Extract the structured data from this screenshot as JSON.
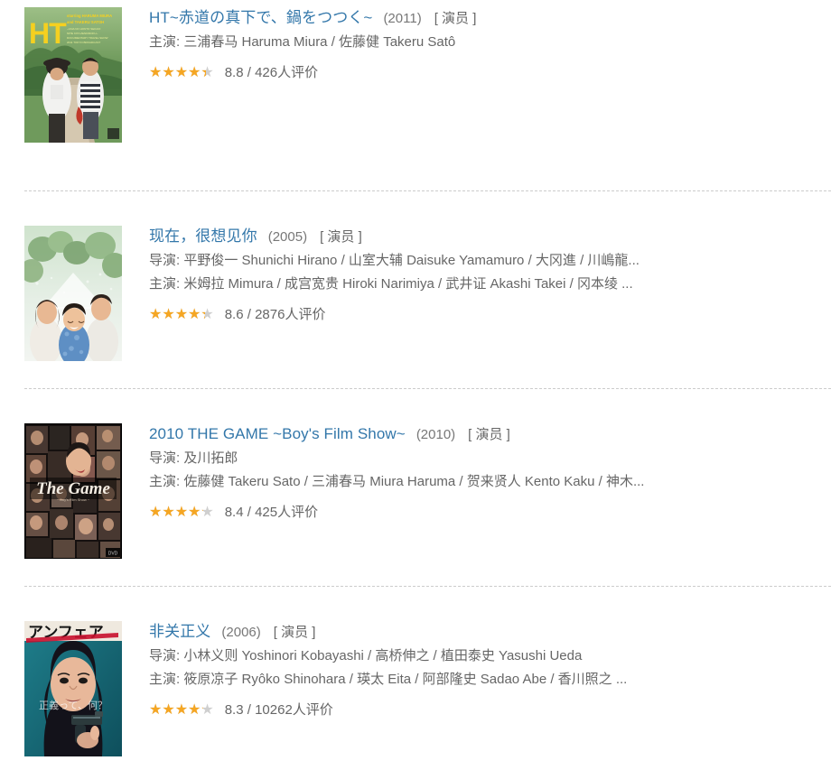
{
  "page": {
    "accent_link_color": "#3377aa",
    "star_color": "#f5a623",
    "star_empty_color": "#cfcfcf",
    "text_color": "#666666"
  },
  "rating_suffix": "人评价",
  "items": [
    {
      "title": "HT~赤道の真下で、鍋をつつく~",
      "year": "(2011)",
      "role": "[ 演员 ]",
      "credits": [
        "主演: 三浦春马 Haruma Miura / 佐藤健 Takeru Satô"
      ],
      "rating": "8.8",
      "votes": "426",
      "rating_text": "8.8 / 426人评价",
      "stars_percent": 88,
      "poster_alt": "HT~赤道の真下で、鍋をつつく~ 海报"
    },
    {
      "title": "现在，很想见你",
      "year": "(2005)",
      "role": "[ 演员 ]",
      "credits": [
        "导演: 平野俊一 Shunichi Hirano / 山室大辅 Daisuke Yamamuro / 大冈進 / 川嶋龍...",
        "主演: 米姆拉 Mimura / 成宫宽贵 Hiroki Narimiya / 武井证 Akashi Takei / 冈本绫 ..."
      ],
      "rating": "8.6",
      "votes": "2876",
      "rating_text": "8.6 / 2876人评价",
      "stars_percent": 86,
      "poster_alt": "现在，很想见你 海报"
    },
    {
      "title": "2010 THE GAME ~Boy's Film Show~",
      "year": "(2010)",
      "role": "[ 演员 ]",
      "credits": [
        "导演: 及川拓郎",
        "主演: 佐藤健 Takeru Sato / 三浦春马 Miura Haruma / 贺来贤人 Kento Kaku / 神木..."
      ],
      "rating": "8.4",
      "votes": "425",
      "rating_text": "8.4 / 425人评价",
      "stars_percent": 84,
      "poster_alt": "2010 THE GAME ~Boy's Film Show~ 海报"
    },
    {
      "title": "非关正义",
      "year": "(2006)",
      "role": "[ 演员 ]",
      "credits": [
        "导演: 小林义则 Yoshinori Kobayashi / 高桥伸之 / 植田泰史 Yasushi Ueda",
        "主演: 筱原凉子 Ryôko Shinohara / 瑛太 Eita / 阿部隆史 Sadao Abe / 香川照之 ..."
      ],
      "rating": "8.3",
      "votes": "10262",
      "rating_text": "8.3 / 10262人评价",
      "stars_percent": 83,
      "poster_alt": "非关正义 海报"
    }
  ]
}
